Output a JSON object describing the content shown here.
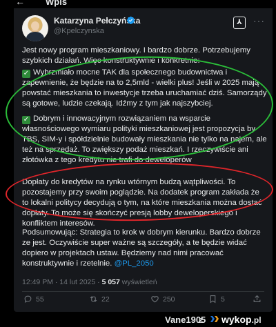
{
  "header": {
    "back_glyph": "←",
    "title": "Wpis"
  },
  "tweet": {
    "author": {
      "name": "Katarzyna Pełczyńska",
      "handle": "@Kpelczynska"
    },
    "grok_label": "⅄",
    "more_label": "···",
    "paragraphs": {
      "p1": "Jest nowy program mieszkaniowy. I bardzo dobrze. Potrzebujemy szybkich działań. Więc konstruktywnie i konkretnie:",
      "p2": "Wybrzmiało mocne TAK dla społecznego budownictwa i zapewnienie, że będzie na to 2,5mld - wielki plus! Jeśli w 2025 mają powstać mieszkania to inwestycje trzeba uruchamiać dziś. Samorządy są gotowe, ludzie czekają. Idźmy z tym jak najszybciej.",
      "p3": "Dobrym i innowacyjnym rozwiązaniem na wsparcie własnościowego wymiaru polityki mieszkaniowej jest propozycja by TBS, SIM-y i spółdzielnie budowały mieszkania nie tylko na najem, ale też na sprzedaż. To zwiększy podaż mieszkań. I rzeczywiście ani złotówka z tego kredytu nie trafi do deweloperów",
      "p4": "Dopłaty do kredytów na rynku wtórnym budzą wątpliwości. To pozostajemy przy swoim poglądzie. Na dodatek program zakłada że to lokalni politycy decydują o tym, na które mieszkania można dostać dopłaty. To może się skończyć presją lobby deweloperskiego i konfliktem interesów.",
      "p5_text": "Podsumowując: Strategia to krok w dobrym kierunku. Bardzo dobrze ze jest. Oczywiście super ważne są szczegóły, a te będzie widać dopiero w projektach ustaw. Będziemy nad nimi pracować konstruktywnie i rzetelnie. ",
      "p5_mention": "@PL_2050"
    },
    "check_glyph": "✓",
    "meta": {
      "time": "12:49 PM · 14 lut 2025 · ",
      "views_count": "5 057",
      "views_label": " wyświetleń"
    },
    "actions": {
      "replies": "55",
      "reposts": "22",
      "likes": "250",
      "bookmarks": "5"
    }
  },
  "overlay_colors": {
    "green": "#2bbd39",
    "red": "#e0252a"
  },
  "watermark": {
    "user": "Vane1905",
    "z": "z",
    "site": "wykop",
    "domain": ".pl"
  }
}
